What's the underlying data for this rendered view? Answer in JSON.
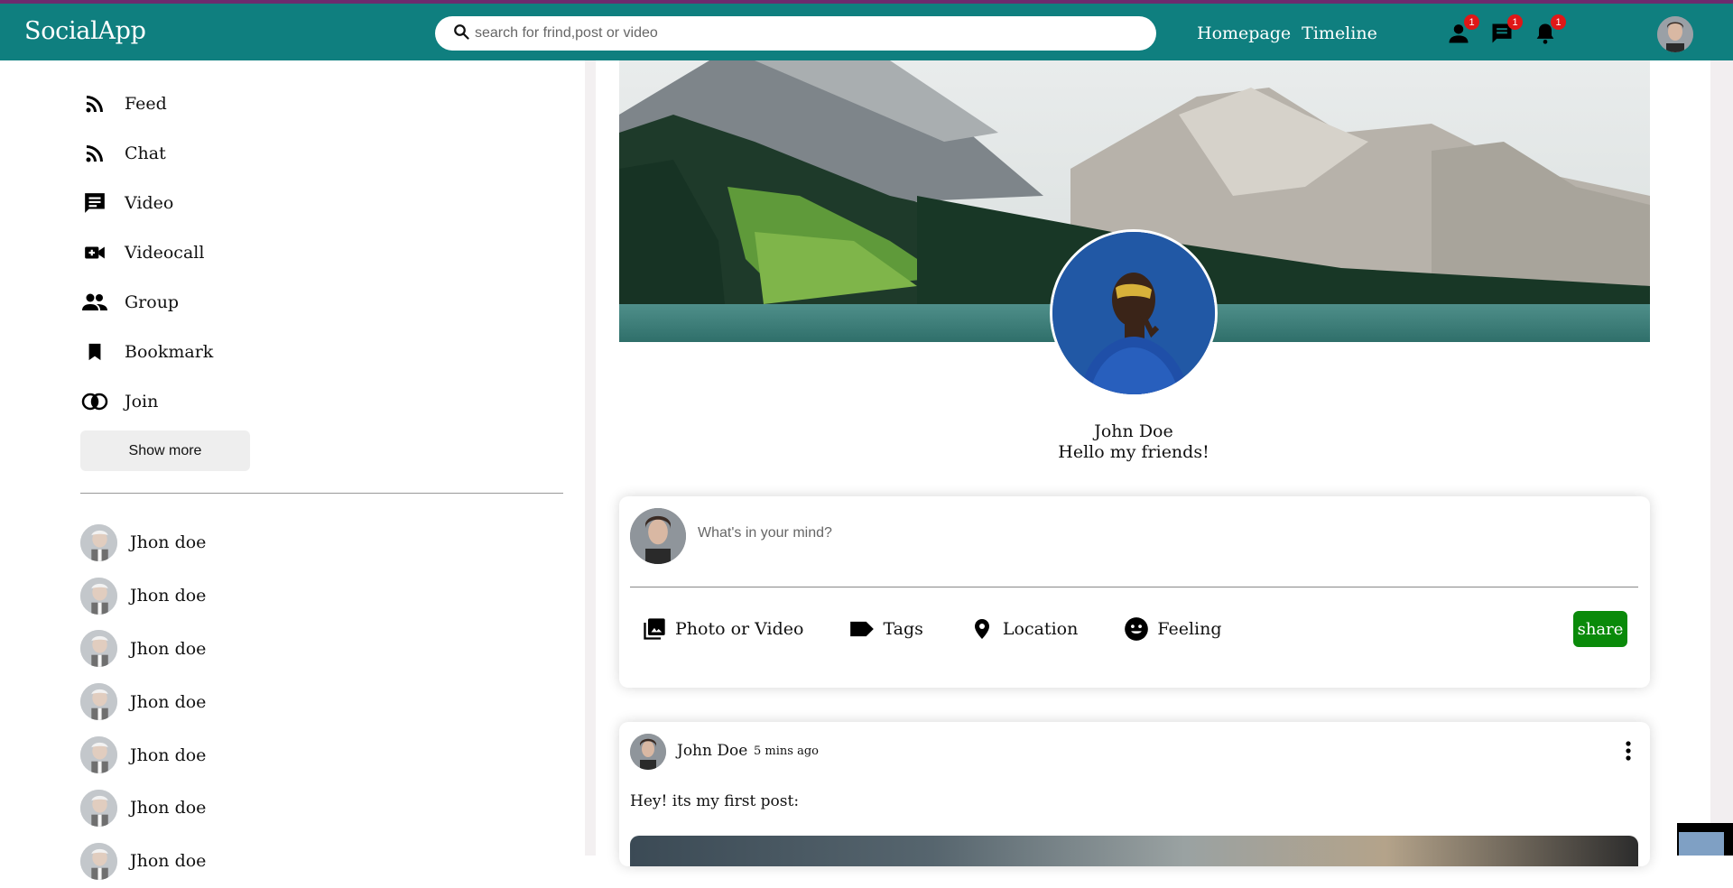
{
  "app": {
    "name": "SocialApp"
  },
  "search": {
    "placeholder": "search for frind,post or video"
  },
  "nav": {
    "links": [
      "Homepage",
      "Timeline"
    ]
  },
  "notifications": {
    "friends": "1",
    "messages": "1",
    "alerts": "1"
  },
  "sidebar": {
    "items": [
      {
        "label": "Feed",
        "icon": "rss-icon"
      },
      {
        "label": "Chat",
        "icon": "rss-icon"
      },
      {
        "label": "Video",
        "icon": "chat-bubble-icon"
      },
      {
        "label": "Videocall",
        "icon": "video-call-icon"
      },
      {
        "label": "Group",
        "icon": "group-icon"
      },
      {
        "label": "Bookmark",
        "icon": "bookmark-icon"
      },
      {
        "label": "Join",
        "icon": "join-icon"
      }
    ],
    "show_more": "Show more",
    "friends": [
      "Jhon doe",
      "Jhon doe",
      "Jhon doe",
      "Jhon doe",
      "Jhon doe",
      "Jhon doe",
      "Jhon doe"
    ]
  },
  "profile": {
    "name": "John Doe",
    "status": "Hello my friends!"
  },
  "share": {
    "placeholder": "What's in your mind?",
    "options": [
      {
        "label": "Photo or Video",
        "icon": "photo-library-icon"
      },
      {
        "label": "Tags",
        "icon": "tag-icon"
      },
      {
        "label": "Location",
        "icon": "location-pin-icon"
      },
      {
        "label": "Feeling",
        "icon": "emoji-icon"
      }
    ],
    "button": "share"
  },
  "post": {
    "user": "John Doe",
    "time": "5 mins ago",
    "text": "Hey! its my first post:"
  },
  "colors": {
    "topbar": "#0f7f7f",
    "share_button": "#0a8a0a",
    "badge": "#e01717"
  }
}
